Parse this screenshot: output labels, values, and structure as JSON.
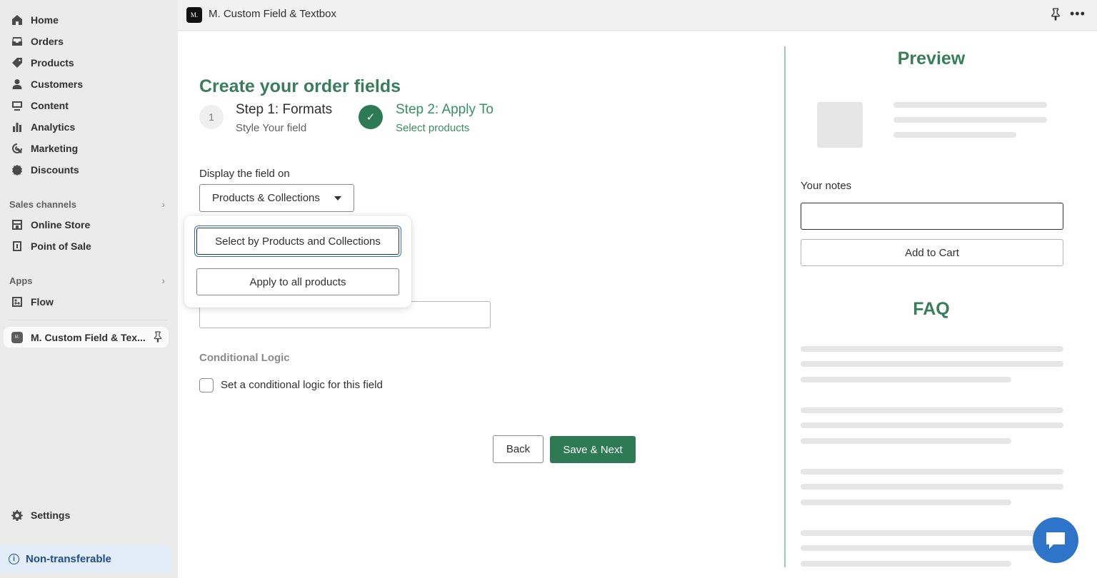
{
  "sidebar": {
    "nav": [
      {
        "label": "Home",
        "icon": "home-icon"
      },
      {
        "label": "Orders",
        "icon": "inbox-icon"
      },
      {
        "label": "Products",
        "icon": "tag-icon"
      },
      {
        "label": "Customers",
        "icon": "person-icon"
      },
      {
        "label": "Content",
        "icon": "content-icon"
      },
      {
        "label": "Analytics",
        "icon": "bar-chart-icon"
      },
      {
        "label": "Marketing",
        "icon": "target-icon"
      },
      {
        "label": "Discounts",
        "icon": "discount-icon"
      }
    ],
    "sales_channels_label": "Sales channels",
    "sales_channels": [
      {
        "label": "Online Store",
        "icon": "store-icon"
      },
      {
        "label": "Point of Sale",
        "icon": "pos-icon"
      }
    ],
    "apps_label": "Apps",
    "apps": [
      {
        "label": "Flow",
        "icon": "flow-icon"
      }
    ],
    "active_app": {
      "label": "M. Custom Field & Tex...",
      "logo_text": "M."
    },
    "settings_label": "Settings",
    "non_transferable": "Non-transferable"
  },
  "topbar": {
    "logo_text": "M.",
    "title": "M. Custom Field & Textbox"
  },
  "main": {
    "title": "Create your order fields",
    "step1": {
      "number": "1",
      "title": "Step 1: Formats",
      "subtitle": "Style Your field"
    },
    "step2": {
      "check": "✓",
      "title": "Step 2: Apply To",
      "subtitle": "Select products"
    },
    "display_label": "Display the field on",
    "display_value": "Products & Collections",
    "conditional_label": "Conditional Logic",
    "conditional_checkbox_label": "Set a conditional logic for this field",
    "back_label": "Back",
    "save_label": "Save & Next"
  },
  "dropdown": {
    "options": [
      "Select by Products and Collections",
      "Apply to all products"
    ]
  },
  "preview": {
    "title": "Preview",
    "notes_label": "Your notes",
    "notes_value": "",
    "add_to_cart_label": "Add to Cart",
    "faq_title": "FAQ"
  },
  "colors": {
    "accent_green": "#2d7a55",
    "title_green": "#3a7d5c",
    "focus_blue": "#2c6ecb",
    "chat_blue": "#2e74c9"
  }
}
